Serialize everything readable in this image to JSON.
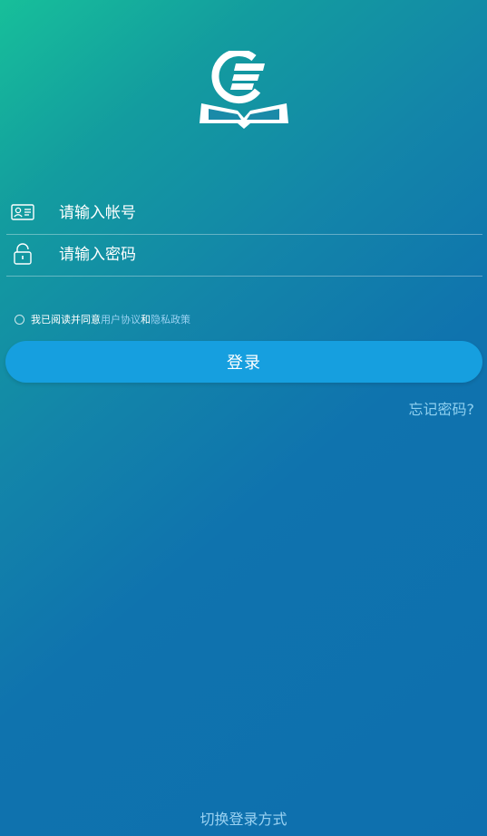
{
  "logo": {
    "icon": "book-logo-icon"
  },
  "form": {
    "account": {
      "icon": "id-card-icon",
      "placeholder": "请输入帐号"
    },
    "password": {
      "icon": "lock-icon",
      "placeholder": "请输入密码"
    }
  },
  "agreement": {
    "prefix": "我已阅读并同意",
    "user_agreement": "用户协议",
    "and": "和",
    "privacy_policy": "隐私政策"
  },
  "login_button": "登录",
  "forgot_password": "忘记密码?",
  "switch_login": "切换登录方式",
  "colors": {
    "button": "#169fdf",
    "link": "#9ad2f2",
    "gradient_start": "#17bf9a",
    "gradient_end": "#0e6fae"
  }
}
